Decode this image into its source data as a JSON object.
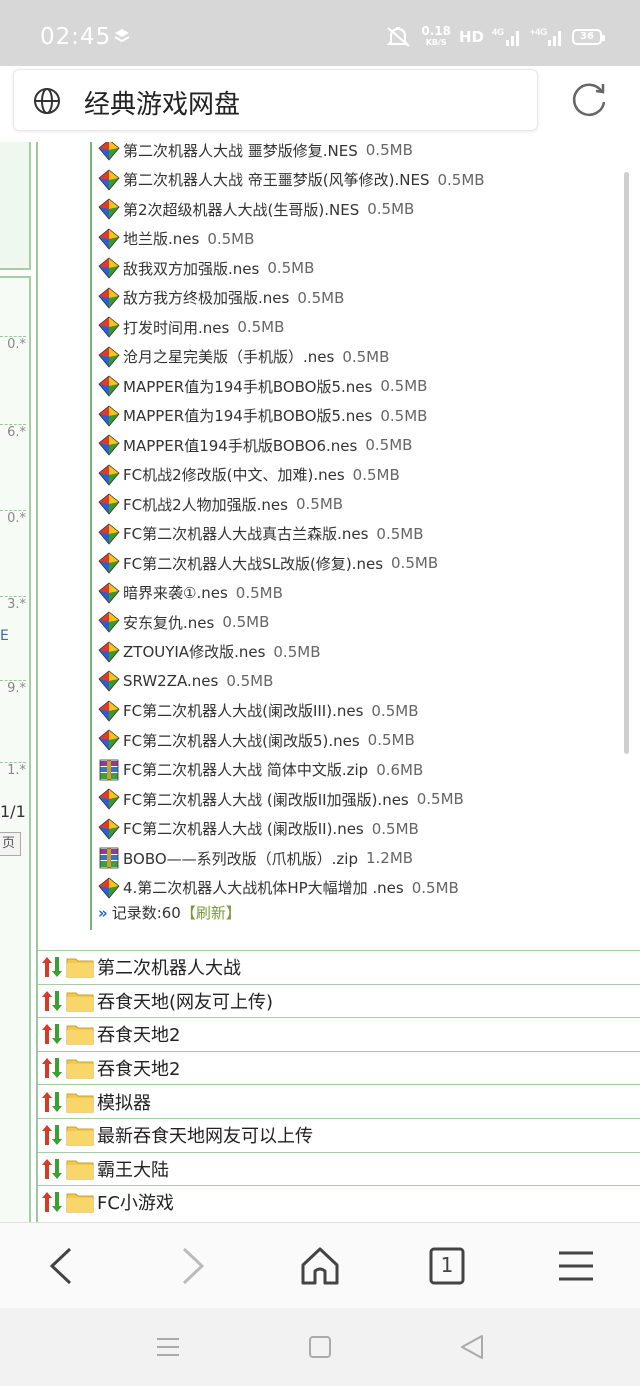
{
  "status_bar": {
    "time": "02:45",
    "net_speed_value": "0.18",
    "net_speed_unit": "KB/S",
    "hd_label": "HD",
    "signal1_label": "4G",
    "signal2_label": "+4G",
    "battery": "36"
  },
  "address_bar": {
    "title": "经典游戏网盘"
  },
  "left_panel": {
    "numbers": [
      "0.*",
      "6.*",
      "0.*",
      "3.*",
      "9.*",
      "1.*"
    ],
    "e_label": "E",
    "page_label": "1/1",
    "page_button": "页"
  },
  "files": [
    {
      "name": "第二次机器人大战 噩梦版修复.NES",
      "size": "0.5MB",
      "type": "nes"
    },
    {
      "name": "第二次机器人大战 帝王噩梦版(风筝修改).NES",
      "size": "0.5MB",
      "type": "nes"
    },
    {
      "name": "第2次超级机器人大战(生哥版).NES",
      "size": "0.5MB",
      "type": "nes"
    },
    {
      "name": "地兰版.nes",
      "size": "0.5MB",
      "type": "nes"
    },
    {
      "name": "敌我双方加强版.nes",
      "size": "0.5MB",
      "type": "nes"
    },
    {
      "name": "敌方我方终极加强版.nes",
      "size": "0.5MB",
      "type": "nes"
    },
    {
      "name": "打发时间用.nes",
      "size": "0.5MB",
      "type": "nes"
    },
    {
      "name": "沧月之星完美版（手机版）.nes",
      "size": "0.5MB",
      "type": "nes"
    },
    {
      "name": "MAPPER值为194手机BOBO版5.nes",
      "size": "0.5MB",
      "type": "nes"
    },
    {
      "name": "MAPPER值为194手机BOBO版5.nes",
      "size": "0.5MB",
      "type": "nes"
    },
    {
      "name": "MAPPER值194手机版BOBO6.nes",
      "size": "0.5MB",
      "type": "nes"
    },
    {
      "name": "FC机战2修改版(中文、加难).nes",
      "size": "0.5MB",
      "type": "nes"
    },
    {
      "name": "FC机战2人物加强版.nes",
      "size": "0.5MB",
      "type": "nes"
    },
    {
      "name": "FC第二次机器人大战真古兰森版.nes",
      "size": "0.5MB",
      "type": "nes"
    },
    {
      "name": "FC第二次机器人大战SL改版(修复).nes",
      "size": "0.5MB",
      "type": "nes"
    },
    {
      "name": "暗界来袭①.nes",
      "size": "0.5MB",
      "type": "nes"
    },
    {
      "name": "安东复仇.nes",
      "size": "0.5MB",
      "type": "nes"
    },
    {
      "name": "ZTOUYIA修改版.nes",
      "size": "0.5MB",
      "type": "nes"
    },
    {
      "name": "SRW2ZA.nes",
      "size": "0.5MB",
      "type": "nes"
    },
    {
      "name": "FC第二次机器人大战(阑改版III).nes",
      "size": "0.5MB",
      "type": "nes"
    },
    {
      "name": "FC第二次机器人大战(阑改版5).nes",
      "size": "0.5MB",
      "type": "nes"
    },
    {
      "name": "FC第二次机器人大战 简体中文版.zip",
      "size": "0.6MB",
      "type": "zip"
    },
    {
      "name": "FC第二次机器人大战 (阑改版II加强版).nes",
      "size": "0.5MB",
      "type": "nes"
    },
    {
      "name": "FC第二次机器人大战 (阑改版II).nes",
      "size": "0.5MB",
      "type": "nes"
    },
    {
      "name": "BOBO——系列改版（爪机版）.zip",
      "size": "1.2MB",
      "type": "zip"
    },
    {
      "name": "4.第二次机器人大战机体HP大幅增加 .nes",
      "size": "0.5MB",
      "type": "nes"
    }
  ],
  "records": {
    "arrow": "»",
    "label": "记录数:60",
    "refresh": "【刷新】"
  },
  "folders": [
    {
      "name": "第二次机器人大战"
    },
    {
      "name": "吞食天地(网友可上传)"
    },
    {
      "name": "吞食天地2"
    },
    {
      "name": "吞食天地2"
    },
    {
      "name": "模拟器"
    },
    {
      "name": "最新吞食天地网友可以上传"
    },
    {
      "name": "霸王大陆"
    },
    {
      "name": "FC小游戏"
    }
  ],
  "nav": {
    "tab_count": "1"
  },
  "colors": {
    "status_bar_bg": "#d7d7d7",
    "green_border": "#9cc89c",
    "folder_yellow": "#f4c84a"
  }
}
